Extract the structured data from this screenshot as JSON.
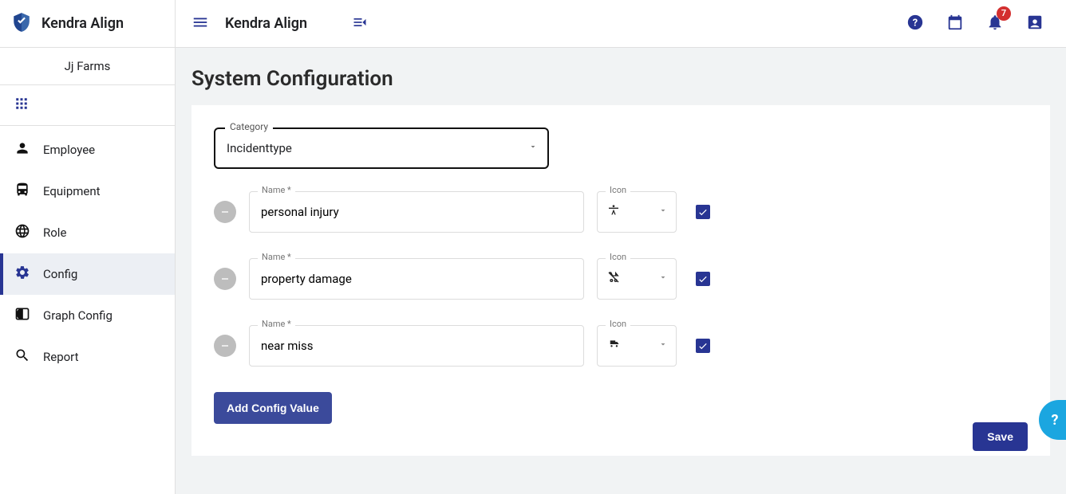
{
  "brand": {
    "name": "Kendra Align"
  },
  "org_name": "Jj Farms",
  "sidebar": {
    "items": [
      {
        "label": "Employee",
        "icon": "person-icon",
        "active": false
      },
      {
        "label": "Equipment",
        "icon": "bus-icon",
        "active": false
      },
      {
        "label": "Role",
        "icon": "globe-icon",
        "active": false
      },
      {
        "label": "Config",
        "icon": "settings-icon",
        "active": true
      },
      {
        "label": "Graph Config",
        "icon": "contrast-icon",
        "active": false
      },
      {
        "label": "Report",
        "icon": "search-icon",
        "active": false
      }
    ]
  },
  "topbar": {
    "title": "Kendra Align",
    "notifications_count": "7"
  },
  "page": {
    "title": "System Configuration"
  },
  "form": {
    "category": {
      "label": "Category",
      "value": "Incidenttype"
    },
    "name_label": "Name *",
    "icon_label": "Icon",
    "rows": [
      {
        "name": "personal injury",
        "icon": "accessibility-icon",
        "checked": true
      },
      {
        "name": "property damage",
        "icon": "stroller-off-icon",
        "checked": true
      },
      {
        "name": "near miss",
        "icon": "shipping-icon",
        "checked": true
      }
    ],
    "add_label": "Add Config Value",
    "save_label": "Save"
  },
  "help_fab": "?"
}
